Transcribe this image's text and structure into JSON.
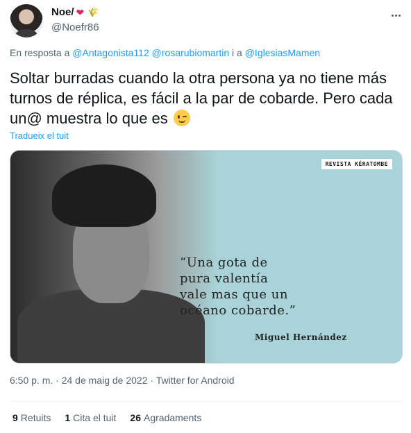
{
  "author": {
    "display_name": "Noe/",
    "handle": "@Noefr86",
    "emoji_icons": [
      "heart-icon",
      "wheat-icon"
    ]
  },
  "reply": {
    "prefix": "En resposta a",
    "mentions": [
      "@Antagonista112",
      "@rosarubiomartin",
      "@IglesiasMamen"
    ],
    "joiner": "i a"
  },
  "tweet": {
    "text": "Soltar burradas cuando la otra persona ya no tiene más turnos de réplica, es fácil a la par de cobarde. Pero cada un@ muestra lo que es",
    "emoji": "wink-emoji",
    "translate_label": "Tradueix el tuit"
  },
  "media": {
    "brand": "REVISTA KÉRATOMBE",
    "quote_lines": [
      "“Una gota de",
      "pura valentía",
      "vale mas que un",
      "océano cobarde.”"
    ],
    "quote_author": "Miguel Hernández"
  },
  "meta": {
    "time": "6:50 p. m.",
    "date": "24 de maig de 2022",
    "source": "Twitter for Android"
  },
  "stats": {
    "retweets_count": "9",
    "retweets_label": "Retuits",
    "quotes_count": "1",
    "quotes_label": "Cita el tuit",
    "likes_count": "26",
    "likes_label": "Agradaments"
  },
  "colors": {
    "link": "#1d9bf0",
    "secondary_text": "#536471",
    "media_bg": "#a9d3d8"
  }
}
